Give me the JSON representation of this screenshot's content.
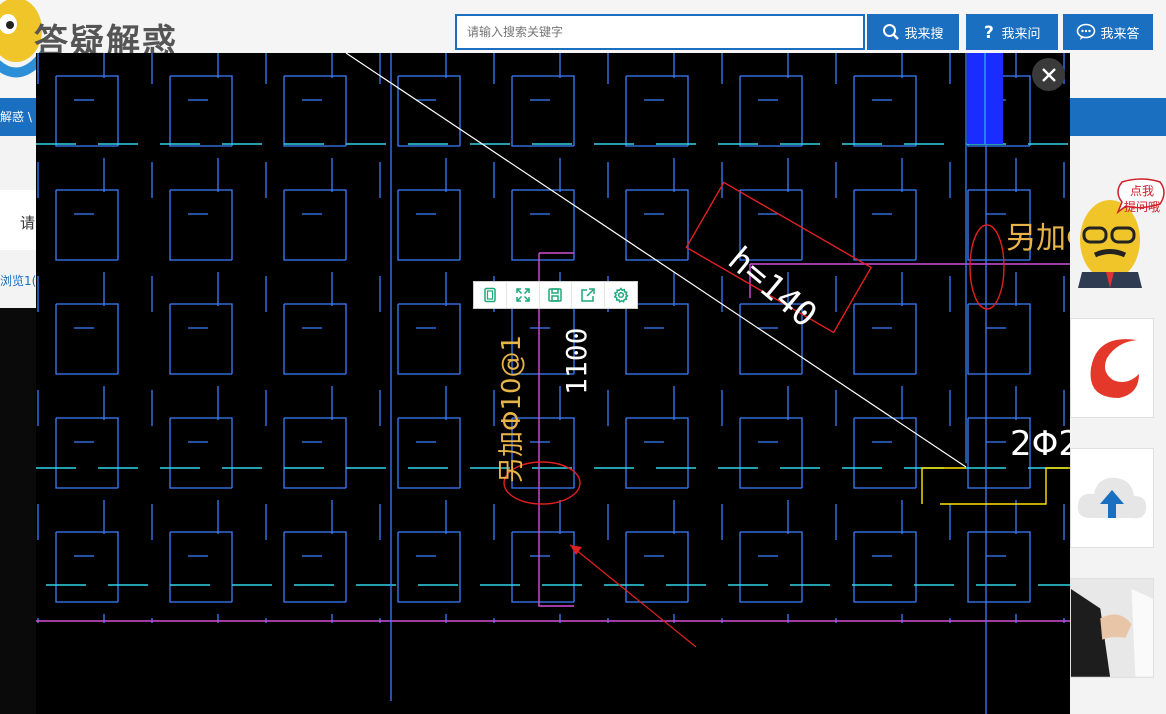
{
  "header": {
    "site_title": "答疑解惑",
    "search_placeholder": "请输入搜索关键字",
    "search_button": "我来搜",
    "ask_button": "我来问",
    "answer_button": "我来答"
  },
  "nav": {
    "breadcrumb": "解惑 \\ 孝"
  },
  "left": {
    "question_text": "请",
    "views_text": "浏览1("
  },
  "right": {
    "speech_bubble": [
      "点我",
      "提问哦"
    ]
  },
  "viewer": {
    "annotations": [
      {
        "text": "h=140",
        "color": "#ffffff"
      },
      {
        "text": "另加Φ10@1",
        "color": "#e8b44a"
      },
      {
        "text": "1100",
        "color": "#ffffff"
      },
      {
        "text": "另加Φ",
        "color": "#e8b44a"
      },
      {
        "text": "2Φ2",
        "color": "#ffffff"
      }
    ],
    "toolbar_icons": [
      "fit-page-icon",
      "fullscreen-icon",
      "save-icon",
      "share-icon",
      "settings-icon"
    ]
  },
  "colors": {
    "brand_blue": "#1a6fc0",
    "cad_blue": "#3b7fff",
    "cad_cyan": "#2fd6e6",
    "cad_magenta": "#d24fd6",
    "cad_red": "#e02020",
    "cad_yellow": "#ffe600"
  }
}
